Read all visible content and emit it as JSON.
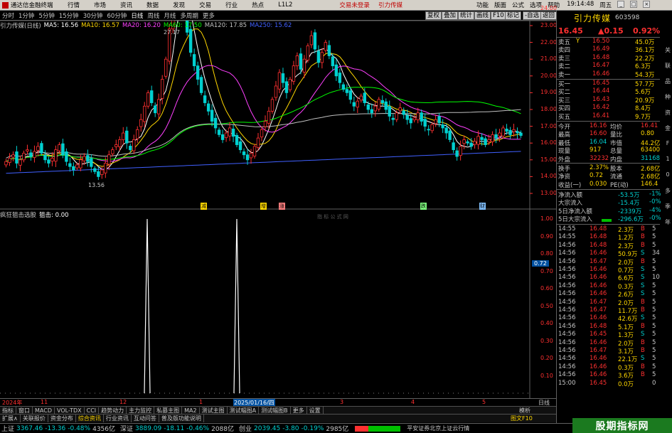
{
  "menubar": {
    "app_title": "通达信金融终端",
    "items": [
      "行情",
      "市场",
      "资讯",
      "数据",
      "发现",
      "交易",
      "行业",
      "热点",
      "L1L2"
    ],
    "trade_login": "交易未登录",
    "trade_order": "引力传媒",
    "right_items": [
      "功能",
      "版面",
      "公式",
      "选项",
      "帮助"
    ],
    "clock": "19:14:48",
    "mode": "周五"
  },
  "periodbar": {
    "items": [
      "分时",
      "1分钟",
      "5分钟",
      "15分钟",
      "30分钟",
      "60分钟",
      "日线",
      "周线",
      "月线",
      "多周期",
      "更多"
    ],
    "active": "日线",
    "tools": [
      "复权",
      "叠加",
      "统计",
      "画线",
      "F10",
      "标记",
      "-自选",
      "返回"
    ]
  },
  "main_info": {
    "stock": "引力传媒(日线)",
    "ma5": "MA5: 16.56",
    "ma10": "MA10: 16.57",
    "ma20": "MA20: 16.20",
    "ma60": "MA60: 17.50",
    "ma120": "MA120: 17.85",
    "ma250": "MA250: 15.62"
  },
  "price_axis": [
    "26.00",
    "25.00",
    "24.00",
    "23.00",
    "22.00",
    "21.00",
    "20.00",
    "19.00",
    "18.00",
    "17.00",
    "16.00",
    "15.00",
    "14.00",
    "13.00"
  ],
  "annotations": {
    "high": "27.17",
    "low": "13.56",
    "markers": [
      "减",
      "增",
      "涨",
      "跌",
      "财"
    ]
  },
  "sub_info": {
    "name": "疯狂狙击选股",
    "value": "狙击: 0.00",
    "watermark": "指 标 公 式 网",
    "axis": [
      "1.00",
      "0.90",
      "0.80",
      "0.70",
      "0.60",
      "0.50",
      "0.40",
      "0.30",
      "0.20",
      "0.10"
    ],
    "cursor_value": "0.72"
  },
  "date_axis": {
    "labels": [
      "2024年",
      "11",
      "12",
      "1",
      "2025/01/16/四",
      "3",
      "4",
      "5"
    ],
    "right_label": "日线"
  },
  "indicator_tabs": [
    "指标",
    "窗口",
    "MACD",
    "VOL-TDX",
    "CCI",
    "趋势动力",
    "主力监控",
    "私募主图",
    "MA2",
    "测试主图",
    "测试幅图A",
    "测试幅图B",
    "更多",
    "设置"
  ],
  "bottom_tabs": [
    "扩展∧",
    "关联报价",
    "资金分布",
    "综合资讯",
    "行业资讯",
    "互动问答",
    "普及版功能说明"
  ],
  "bottom_right": [
    "图文F10",
    "模析"
  ],
  "quote": {
    "name": "引力传媒",
    "code": "603598",
    "price": "16.45",
    "change": "▲0.15",
    "pct": "0.92%",
    "asks": [
      {
        "label": "卖五",
        "flag": "Y",
        "price": "16.50",
        "vol": "45.0万"
      },
      {
        "label": "卖四",
        "flag": "",
        "price": "16.49",
        "vol": "36.1万"
      },
      {
        "label": "卖三",
        "flag": "",
        "price": "16.48",
        "vol": "22.2万"
      },
      {
        "label": "卖二",
        "flag": "",
        "price": "16.47",
        "vol": "6.3万"
      },
      {
        "label": "卖一",
        "flag": "",
        "price": "16.46",
        "vol": "54.3万"
      }
    ],
    "bids": [
      {
        "label": "买一",
        "price": "16.45",
        "vol": "57.7万"
      },
      {
        "label": "买二",
        "price": "16.44",
        "vol": "5.6万"
      },
      {
        "label": "买三",
        "price": "16.43",
        "vol": "20.9万"
      },
      {
        "label": "买四",
        "price": "16.42",
        "vol": "8.4万"
      },
      {
        "label": "买五",
        "price": "16.41",
        "vol": "9.7万"
      }
    ],
    "stats": [
      {
        "l1": "今开",
        "v1": "16.16",
        "l2": "均价",
        "v2": "16.41"
      },
      {
        "l1": "最高",
        "v1": "16.60",
        "l2": "量比",
        "v2": "0.80"
      },
      {
        "l1": "最低",
        "v1": "16.04",
        "l2": "市值",
        "v2": "44.2亿"
      },
      {
        "l1": "现量",
        "v1": "917",
        "l2": "总量",
        "v2": "63400"
      },
      {
        "l1": "外盘",
        "v1": "32232",
        "l2": "内盘",
        "v2": "31168"
      }
    ],
    "stats2": [
      {
        "l1": "换手",
        "v1": "2.37%",
        "l2": "股本",
        "v2": "2.68亿"
      },
      {
        "l1": "净资",
        "v1": "0.72",
        "l2": "流通",
        "v2": "2.68亿"
      },
      {
        "l1": "收益(一)",
        "v1": "0.030",
        "l2": "PE(动)",
        "v2": "146.4"
      }
    ],
    "flows": [
      {
        "label": "净流入额",
        "val": "-53.5万",
        "pct": "-1%"
      },
      {
        "label": "大宗流入",
        "val": "-15.4万",
        "pct": "-0%"
      },
      {
        "label": "5日净流入额",
        "val": "-2339万",
        "pct": "-4%"
      },
      {
        "label": "5日大宗流入",
        "val": "-296.6万",
        "pct": "-0%"
      }
    ]
  },
  "ticks": [
    {
      "t": "14:55",
      "p": "16.48",
      "v": "2.3万",
      "s": "B",
      "n": "5"
    },
    {
      "t": "14:55",
      "p": "16.48",
      "v": "1.2万",
      "s": "B",
      "n": "5"
    },
    {
      "t": "14:56",
      "p": "16.48",
      "v": "2.3万",
      "s": "B",
      "n": "5"
    },
    {
      "t": "14:56",
      "p": "16.46",
      "v": "50.9万",
      "s": "S",
      "n": "34"
    },
    {
      "t": "14:56",
      "p": "16.47",
      "v": "2.0万",
      "s": "B",
      "n": "5"
    },
    {
      "t": "14:56",
      "p": "16.46",
      "v": "0.7万",
      "s": "S",
      "n": "5"
    },
    {
      "t": "14:56",
      "p": "16.46",
      "v": "6.6万",
      "s": "S",
      "n": "10"
    },
    {
      "t": "14:56",
      "p": "16.46",
      "v": "0.3万",
      "s": "S",
      "n": "5"
    },
    {
      "t": "14:56",
      "p": "16.46",
      "v": "2.6万",
      "s": "S",
      "n": "5"
    },
    {
      "t": "14:56",
      "p": "16.47",
      "v": "2.0万",
      "s": "B",
      "n": "5"
    },
    {
      "t": "14:56",
      "p": "16.47",
      "v": "11.7万",
      "s": "B",
      "n": "5"
    },
    {
      "t": "14:56",
      "p": "16.46",
      "v": "42.6万",
      "s": "S",
      "n": "5"
    },
    {
      "t": "14:56",
      "p": "16.48",
      "v": "5.1万",
      "s": "B",
      "n": "5"
    },
    {
      "t": "14:56",
      "p": "16.45",
      "v": "1.3万",
      "s": "S",
      "n": "5"
    },
    {
      "t": "14:56",
      "p": "16.46",
      "v": "2.0万",
      "s": "B",
      "n": "5"
    },
    {
      "t": "14:56",
      "p": "16.47",
      "v": "3.1万",
      "s": "B",
      "n": "5"
    },
    {
      "t": "14:56",
      "p": "16.46",
      "v": "22.1万",
      "s": "S",
      "n": "5"
    },
    {
      "t": "14:56",
      "p": "16.46",
      "v": "0.3万",
      "s": "B",
      "n": "5"
    },
    {
      "t": "14:56",
      "p": "16.46",
      "v": "3.6万",
      "s": "B",
      "n": "5"
    },
    {
      "t": "15:00",
      "p": "16.45",
      "v": "0.0万",
      "s": "",
      "n": "0"
    }
  ],
  "sidetabs": [
    "关",
    "联",
    "品",
    "种",
    "资",
    "金",
    "F",
    "1",
    "0",
    "多",
    "季",
    "年"
  ],
  "statusbar": {
    "sh_name": "上证",
    "sh_val": "3367.46",
    "sh_chg": "-13.36",
    "sh_pct": "-0.48%",
    "sh_amt": "4356亿",
    "sz_name": "深证",
    "sz_val": "3889.09",
    "sz_chg": "-18.11",
    "sz_pct": "-0.46%",
    "sz_amt": "2088亿",
    "cy_name": "创业",
    "cy_val": "2039.45",
    "cy_chg": "-3.80",
    "cy_pct": "-0.19%",
    "cy_amt": "2985亿",
    "broker": "平安证券北京上证云行情",
    "site": "股期指标网",
    "url": "www.7gpzb.com"
  },
  "colors": {
    "up": "#ff3030",
    "down": "#00d0d0",
    "ma5": "#ffffff",
    "ma10": "#ffd700",
    "ma20": "#ff40ff",
    "ma60": "#00ff00",
    "ma120": "#c0c0c0",
    "ma250": "#4060ff"
  },
  "chart_data": {
    "type": "candlestick",
    "x_labels": [
      "2024年",
      "11",
      "12",
      "1",
      "2025/01/16/四",
      "3",
      "4",
      "5"
    ],
    "ylim": [
      13,
      27
    ],
    "sub_ylim": [
      0,
      1
    ],
    "sub_spikes": [
      1.0,
      1.0
    ]
  }
}
